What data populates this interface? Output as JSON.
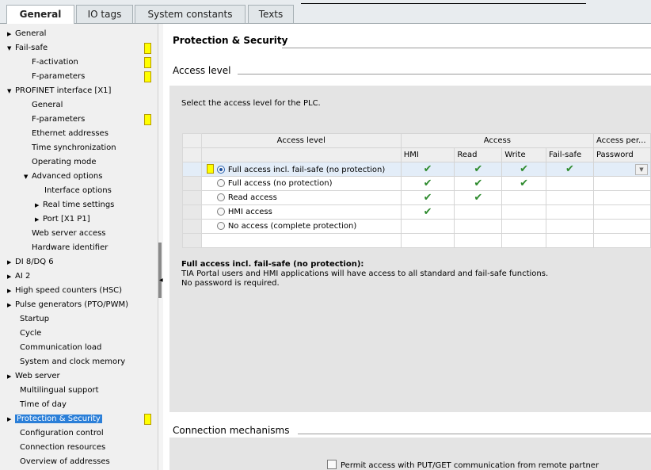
{
  "tabs": [
    {
      "label": "General",
      "active": true
    },
    {
      "label": "IO tags",
      "active": false
    },
    {
      "label": "System constants",
      "active": false
    },
    {
      "label": "Texts",
      "active": false
    }
  ],
  "sidebar": {
    "items": [
      {
        "label": "General",
        "arrow": "right"
      },
      {
        "label": "Fail-safe",
        "arrow": "down",
        "marker": true
      },
      {
        "label": "F-activation",
        "marker": true
      },
      {
        "label": "F-parameters",
        "marker": true
      },
      {
        "label": "PROFINET interface [X1]",
        "arrow": "down"
      },
      {
        "label": "General"
      },
      {
        "label": "F-parameters",
        "marker": true
      },
      {
        "label": "Ethernet addresses"
      },
      {
        "label": "Time synchronization"
      },
      {
        "label": "Operating mode"
      },
      {
        "label": "Advanced options",
        "arrow": "down"
      },
      {
        "label": "Interface options"
      },
      {
        "label": "Real time settings",
        "arrow": "right"
      },
      {
        "label": "Port [X1 P1]",
        "arrow": "right"
      },
      {
        "label": "Web server access"
      },
      {
        "label": "Hardware identifier"
      },
      {
        "label": "DI 8/DQ 6",
        "arrow": "right"
      },
      {
        "label": "AI 2",
        "arrow": "right"
      },
      {
        "label": "High speed counters (HSC)",
        "arrow": "right"
      },
      {
        "label": "Pulse generators (PTO/PWM)",
        "arrow": "right"
      },
      {
        "label": "Startup"
      },
      {
        "label": "Cycle"
      },
      {
        "label": "Communication load"
      },
      {
        "label": "System and clock memory"
      },
      {
        "label": "Web server",
        "arrow": "right"
      },
      {
        "label": "Multilingual support"
      },
      {
        "label": "Time of day"
      },
      {
        "label": "Protection & Security",
        "arrow": "right",
        "selected": true,
        "marker": true
      },
      {
        "label": "Configuration control"
      },
      {
        "label": "Connection resources"
      },
      {
        "label": "Overview of addresses"
      }
    ]
  },
  "main": {
    "section_title": "Protection & Security",
    "access_level_heading": "Access level",
    "select_text": "Select the access level for the PLC.",
    "table": {
      "col_access_level": "Access level",
      "col_access": "Access",
      "col_access_per": "Access per...",
      "sub_headers": [
        "HMI",
        "Read",
        "Write",
        "Fail-safe",
        "Password"
      ],
      "rows": [
        {
          "label": "Full access incl. fail-safe (no protection)",
          "selected": true,
          "hmi": "✔",
          "read": "✔",
          "write": "✔",
          "failsafe": "✔"
        },
        {
          "label": "Full access (no protection)",
          "selected": false,
          "hmi": "✔",
          "read": "✔",
          "write": "✔",
          "failsafe": ""
        },
        {
          "label": "Read access",
          "selected": false,
          "hmi": "✔",
          "read": "✔",
          "write": "",
          "failsafe": ""
        },
        {
          "label": "HMI access",
          "selected": false,
          "hmi": "✔",
          "read": "",
          "write": "",
          "failsafe": ""
        },
        {
          "label": "No access (complete protection)",
          "selected": false,
          "hmi": "",
          "read": "",
          "write": "",
          "failsafe": ""
        }
      ]
    },
    "description": {
      "title": "Full access incl. fail-safe (no protection):",
      "line1": "TIA Portal users and HMI applications will have access to all standard and fail-safe functions.",
      "line2": "No password is required."
    },
    "connection_heading": "Connection mechanisms",
    "putget_label": "Permit access with PUT/GET communication from remote partner"
  },
  "colors": {
    "selection": "#2b7fd8",
    "marker": "#ffff00",
    "check": "#2d8a2d"
  }
}
